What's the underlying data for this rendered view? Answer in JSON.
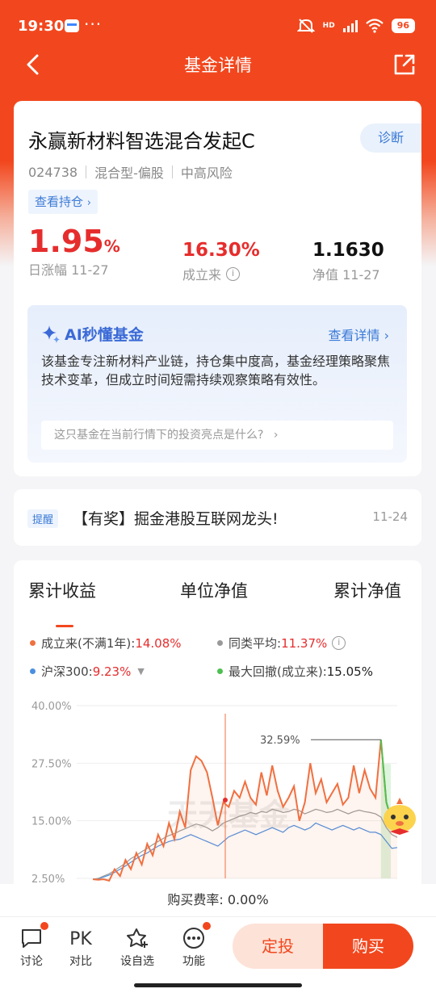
{
  "status_bar": {
    "time": "19:30",
    "dots": "···",
    "net": "HD",
    "battery": "96"
  },
  "nav": {
    "title": "基金详情"
  },
  "fund": {
    "name": "永赢新材料智选混合发起C",
    "code": "024738",
    "type": "混合型-偏股",
    "risk": "中高风险",
    "diagnose_label": "诊断",
    "holdings_label": "查看持仓",
    "daily_change_value": "1.95",
    "daily_change_pct": "%",
    "daily_change_label": "日涨幅 11-27",
    "since_inception_value": "16.30%",
    "since_inception_label": "成立来",
    "nav_value": "1.1630",
    "nav_label": "净值 11-27"
  },
  "ai": {
    "title": "AI秒懂基金",
    "detail_label": "查看详情",
    "summary": "该基金专注新材料产业链，持仓集中度高，基金经理策略聚焦技术变革，但成立时间短需持续观察策略有效性。",
    "question": "这只基金在当前行情下的投资亮点是什么?"
  },
  "notice": {
    "tag": "提醒",
    "text": "【有奖】掘金港股互联网龙头!",
    "date": "11-24"
  },
  "chart_tabs": [
    "累计收益",
    "单位净值",
    "累计净值"
  ],
  "legend": {
    "fund_label": "成立来(不满1年):",
    "fund_value": "14.08%",
    "peer_label": "同类平均:",
    "peer_value": "11.37%",
    "index_label": "沪深300:",
    "index_value": "9.23%",
    "drawdown_label": "最大回撤(成立来):",
    "drawdown_value": "15.05%"
  },
  "colors": {
    "accent": "#f2471e",
    "fund": "#f07040",
    "peer": "#999999",
    "index": "#4a8fe0",
    "drawdown": "#4ec050"
  },
  "chart_data": {
    "type": "line",
    "ylim": [
      2.5,
      40
    ],
    "yticks": [
      "40.00%",
      "27.50%",
      "15.00%",
      "2.50%"
    ],
    "annotation": "32.59%",
    "series": [
      {
        "name": "成立来",
        "values": [
          2.3,
          2.2,
          2.3,
          2.0,
          4.5,
          3.0,
          6.5,
          4.5,
          8.0,
          5.5,
          10.0,
          7.5,
          12.0,
          9.5,
          14.5,
          11.0,
          17.0,
          13.5,
          26.0,
          29.0,
          28.0,
          25.5,
          20.0,
          14.0,
          19.0,
          18.0,
          21.5,
          20.0,
          23.5,
          20.0,
          18.5,
          25.5,
          20.5,
          27.0,
          21.5,
          18.0,
          20.0,
          22.5,
          15.0,
          19.0,
          27.5,
          21.0,
          24.0,
          19.0,
          21.0,
          23.0,
          18.5,
          20.0,
          27.0,
          21.0,
          26.0,
          22.0,
          20.0,
          32.6,
          19.0,
          15.0,
          14.1
        ]
      },
      {
        "name": "同类平均",
        "values": [
          2.3,
          2.5,
          3.0,
          3.5,
          4.2,
          5.0,
          5.8,
          6.8,
          7.5,
          8.3,
          9.0,
          9.8,
          10.5,
          11.2,
          11.8,
          12.2,
          12.8,
          13.3,
          13.8,
          14.3,
          14.0,
          13.5,
          12.8,
          13.5,
          14.5,
          15.0,
          15.5,
          16.0,
          16.3,
          16.8,
          16.5,
          17.0,
          16.8,
          17.5,
          17.2,
          16.8,
          17.0,
          17.5,
          17.2,
          16.5,
          17.0,
          17.5,
          17.2,
          16.8,
          17.0,
          17.5,
          17.0,
          16.5,
          17.0,
          17.3,
          17.0,
          16.8,
          16.5,
          15.8,
          13.5,
          12.0,
          11.4
        ]
      },
      {
        "name": "沪深300",
        "values": [
          2.3,
          2.4,
          2.8,
          3.2,
          3.8,
          4.5,
          5.2,
          6.0,
          6.8,
          7.5,
          8.0,
          8.8,
          9.5,
          10.0,
          10.5,
          10.8,
          11.0,
          11.5,
          12.0,
          11.5,
          11.0,
          10.5,
          10.0,
          9.5,
          10.5,
          11.5,
          12.0,
          12.5,
          13.0,
          12.5,
          12.0,
          12.5,
          13.0,
          13.5,
          13.0,
          12.5,
          13.5,
          14.0,
          13.5,
          13.0,
          13.5,
          14.5,
          14.0,
          13.5,
          13.0,
          13.5,
          14.0,
          13.5,
          13.0,
          13.5,
          13.0,
          12.5,
          12.5,
          12.0,
          10.5,
          9.0,
          9.2
        ]
      }
    ]
  },
  "fee": {
    "label": "购买费率:",
    "value": "0.00%"
  },
  "toolbar": {
    "discuss": "讨论",
    "pk_icon": "PK",
    "compare": "对比",
    "watchlist": "设自选",
    "functions": "功能",
    "fixed_invest": "定投",
    "buy": "购买"
  }
}
